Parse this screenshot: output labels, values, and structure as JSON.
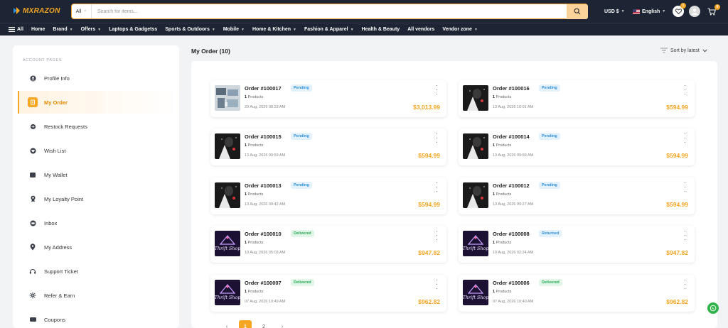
{
  "header": {
    "logo_text": "MXRAZON",
    "search": {
      "category": "All",
      "placeholder": "Search for items..."
    },
    "currency": "USD $",
    "language": "English",
    "wishlist_count": "1",
    "cart_count": "0"
  },
  "nav": {
    "items": [
      {
        "label": "All",
        "icon": "menu-icon"
      },
      {
        "label": "Home"
      },
      {
        "label": "Brand",
        "dropdown": true
      },
      {
        "label": "Offers",
        "dropdown": true
      },
      {
        "label": "Laptops & Gadgetss"
      },
      {
        "label": "Sports & Outdoors",
        "dropdown": true
      },
      {
        "label": "Mobile",
        "dropdown": true
      },
      {
        "label": "Home & Kitchen",
        "dropdown": true
      },
      {
        "label": "Fashion & Apparel",
        "dropdown": true
      },
      {
        "label": "Health & Beauty"
      },
      {
        "label": "All vendors"
      },
      {
        "label": "Vendor zone",
        "dropdown": true
      }
    ]
  },
  "sidebar": {
    "heading": "ACCOUNT PAGES",
    "items": [
      {
        "label": "Profile Info",
        "icon": "user-icon"
      },
      {
        "label": "My Order",
        "icon": "order-icon",
        "active": true
      },
      {
        "label": "Restock Requests",
        "icon": "restock-icon"
      },
      {
        "label": "Wish List",
        "icon": "heart-icon"
      },
      {
        "label": "My Wallet",
        "icon": "wallet-icon"
      },
      {
        "label": "My Loyalty Point",
        "icon": "loyalty-icon"
      },
      {
        "label": "Inbox",
        "icon": "inbox-icon"
      },
      {
        "label": "My Address",
        "icon": "location-icon"
      },
      {
        "label": "Support Ticket",
        "icon": "support-icon"
      },
      {
        "label": "Refer & Earn",
        "icon": "refer-icon"
      },
      {
        "label": "Coupons",
        "icon": "coupon-icon"
      }
    ]
  },
  "main": {
    "title": "My Order (10)",
    "sort_label": "Sort by latest",
    "orders": [
      {
        "number": "Order #100017",
        "status": "Pending",
        "status_type": "pending",
        "qty": "1",
        "products_label": "Products",
        "date": "20 Aug, 2026 08:23 AM",
        "price": "$3,013.99",
        "thumb": "devices"
      },
      {
        "number": "Order #100016",
        "status": "Pending",
        "status_type": "pending",
        "qty": "1",
        "products_label": "Products",
        "date": "13 Aug, 2026 10:01 AM",
        "price": "$594.99",
        "thumb": "dark"
      },
      {
        "number": "Order #100015",
        "status": "Pending",
        "status_type": "pending",
        "qty": "1",
        "products_label": "Products",
        "date": "13 Aug, 2026 09:59 AM",
        "price": "$594.99",
        "thumb": "dark"
      },
      {
        "number": "Order #100014",
        "status": "Pending",
        "status_type": "pending",
        "qty": "1",
        "products_label": "Products",
        "date": "13 Aug, 2026 09:59 AM",
        "price": "$594.99",
        "thumb": "dark"
      },
      {
        "number": "Order #100013",
        "status": "Pending",
        "status_type": "pending",
        "qty": "1",
        "products_label": "Products",
        "date": "13 Aug, 2026 09:42 AM",
        "price": "$594.99",
        "thumb": "dark"
      },
      {
        "number": "Order #100012",
        "status": "Pending",
        "status_type": "pending",
        "qty": "1",
        "products_label": "Products",
        "date": "13 Aug, 2026 09:27 AM",
        "price": "$594.99",
        "thumb": "dark"
      },
      {
        "number": "Order #100010",
        "status": "Delivered",
        "status_type": "delivered",
        "qty": "1",
        "products_label": "Products",
        "date": "10 Aug, 2026 05:03 AM",
        "price": "$947.82",
        "thumb": "thrift"
      },
      {
        "number": "Order #100008",
        "status": "Returned",
        "status_type": "returned",
        "qty": "1",
        "products_label": "Products",
        "date": "10 Aug, 2026 02:24 AM",
        "price": "$947.82",
        "thumb": "thrift"
      },
      {
        "number": "Order #100007",
        "status": "Delivered",
        "status_type": "delivered",
        "qty": "1",
        "products_label": "Products",
        "date": "07 Aug, 2026 10:49 AM",
        "price": "$962.82",
        "thumb": "thrift"
      },
      {
        "number": "Order #100006",
        "status": "Delivered",
        "status_type": "delivered",
        "qty": "1",
        "products_label": "Products",
        "date": "07 Aug, 2026 10:40 AM",
        "price": "$962.82",
        "thumb": "thrift"
      }
    ],
    "thumb_text": "Thrift Shop"
  },
  "pagination": {
    "pages": [
      "1",
      "2"
    ],
    "current": "1",
    "prev": "‹",
    "next": "›"
  },
  "colors": {
    "accent": "#f5a623",
    "header_bg": "#1d2433",
    "pending": "#2f8fd8",
    "delivered": "#29a957"
  }
}
